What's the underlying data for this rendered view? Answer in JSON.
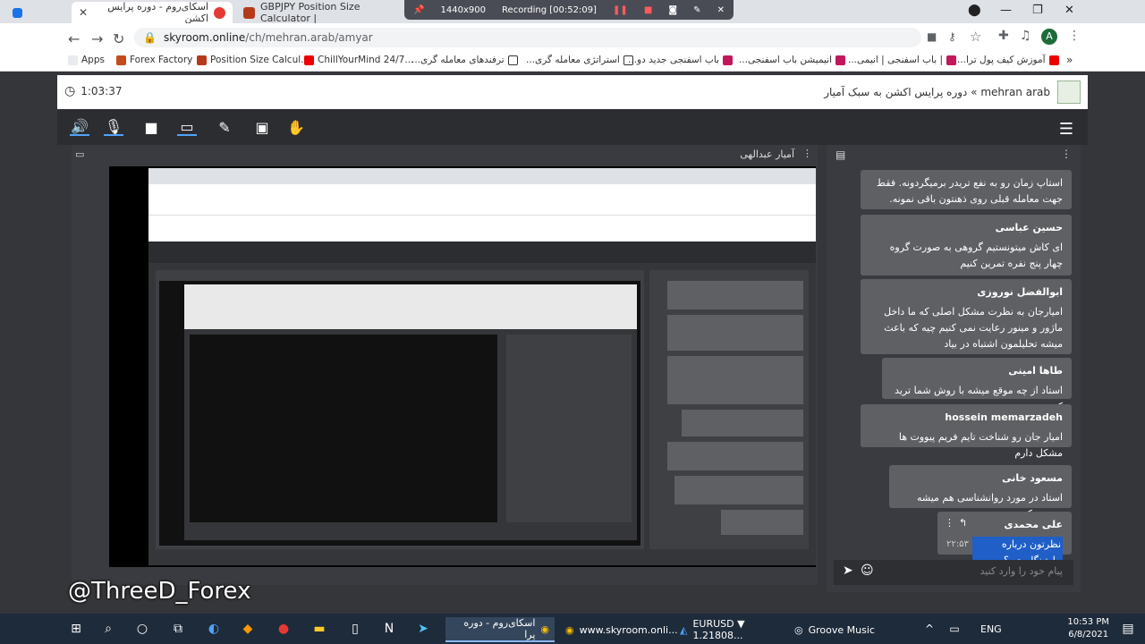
{
  "browser": {
    "tabs": [
      {
        "title": "اسکای‌روم - دوره پرایس اکشن"
      },
      {
        "title": "GBPJPY Position Size Calculator |"
      }
    ],
    "recording": {
      "resolution": "1440x900",
      "status": "Recording [00:52:09]"
    },
    "url_host": "skyroom.online",
    "url_path": "/ch/mehran.arab/amyar",
    "profile_initial": "A",
    "bookmarks": [
      "Apps",
      "Forex Factory",
      "Position Size Calcul...",
      "ChillYourMind 24/7...",
      "ترفندهای معامله گری...",
      "استراتژی معامله گری...",
      "باب اسفنجی جدید دو...",
      "انیمیشن باب اسفنجی...",
      "| باب اسفنجی | انیمی...",
      "آموزش کیف پول ترا..."
    ]
  },
  "app": {
    "timer": "1:03:37",
    "breadcrumb": "mehran arab » دوره پرایس اکشن به سبک آمیار",
    "presenter": "آمیار عبدالهی",
    "chat": [
      {
        "name": "",
        "text": "استاپ زمان رو به نفع تریدر برمیگردونه. فقط جهت معامله قبلی روی ذهنتون باقی نمونه."
      },
      {
        "name": "حسین عباسی",
        "text": "ای کاش میتونستیم گروهی به صورت گروه چهار پنج نفره تمرین کنیم"
      },
      {
        "name": "ابوالفضل نوروزی",
        "text": "امیارجان به نظرت مشکل اصلی که ما داخل ماژور و مینور رعایت نمی کنیم چیه که باعث میشه تحلیلمون اشتباه در بیاد"
      },
      {
        "name": "طاها امینی",
        "text": "استاد از چه موقع میشه با روش شما ترید کرد"
      },
      {
        "name": "hossein memarzadeh",
        "text": "امیار جان رو شناخت تایم فریم پیووت ها مشکل دارم"
      },
      {
        "name": "مسعود خانی",
        "text": "استاد در مورد روانشناسی هم میشه صحبت کنید"
      },
      {
        "name": "علی محمدی",
        "text": "نظرتون درباره مارتینگل چیه؟",
        "time": "۲۲:۵۳"
      }
    ],
    "chat_placeholder": "پیام خود را وارد کنید"
  },
  "taskbar": {
    "apps": [
      {
        "label": "اسکای‌روم - دوره پرا"
      },
      {
        "label": "www.skyroom.onli..."
      },
      {
        "label": "EURUSD ▼ 1.21808..."
      },
      {
        "label": "Groove Music"
      }
    ],
    "lang": "ENG",
    "time": "10:53 PM",
    "date": "6/8/2021"
  },
  "watermark": "@ThreeD_Forex",
  "colors": {
    "taskbar": "#1e2b3b",
    "panel": "#3a3b40",
    "bubble": "#5f6064",
    "toolbar": "#2c2d31"
  }
}
